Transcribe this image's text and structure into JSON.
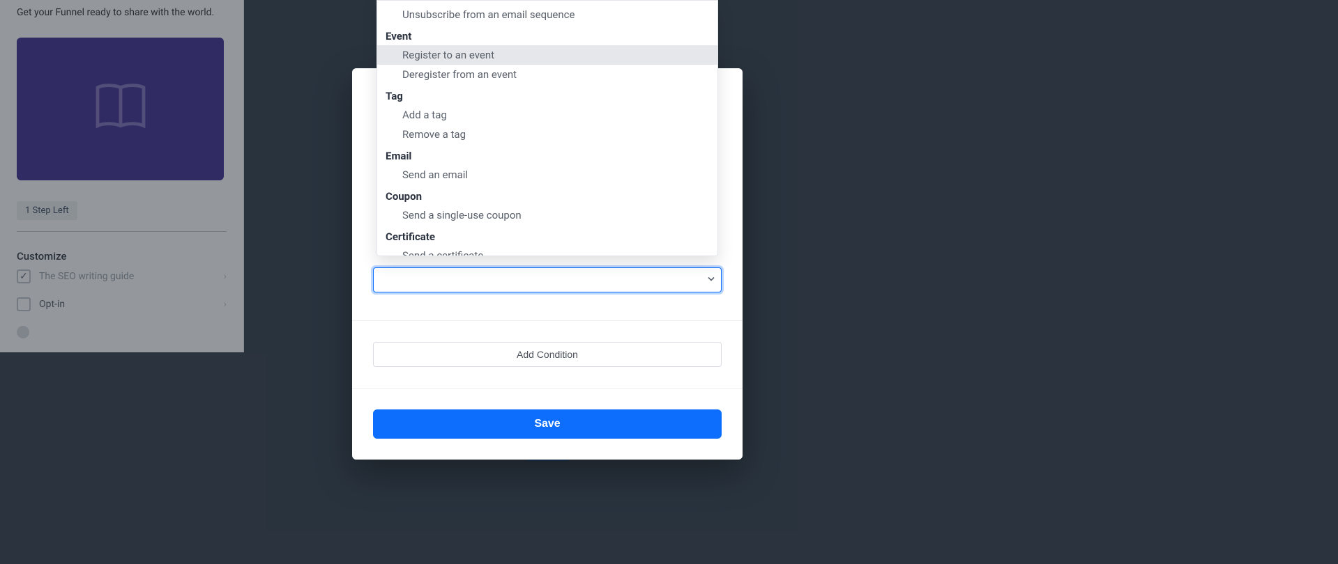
{
  "leftPanel": {
    "subtitle": "Get your Funnel ready to share with the world.",
    "badge": "1 Step Left",
    "customizeTitle": "Customize",
    "items": [
      {
        "label": "The SEO writing guide",
        "checked": true,
        "chevron": true
      },
      {
        "label": "Opt-in",
        "checked": false,
        "chevron": true
      },
      {
        "label": "",
        "checked": false,
        "chevron": false
      }
    ]
  },
  "dropdown": {
    "groups": [
      {
        "label": "",
        "items": [
          "Unsubscribe from an email sequence"
        ]
      },
      {
        "label": "Event",
        "items": [
          "Register to an event",
          "Deregister from an event"
        ]
      },
      {
        "label": "Tag",
        "items": [
          "Add a tag",
          "Remove a tag"
        ]
      },
      {
        "label": "Email",
        "items": [
          "Send an email"
        ]
      },
      {
        "label": "Coupon",
        "items": [
          "Send a single-use coupon"
        ]
      },
      {
        "label": "Certificate",
        "items": [
          "Send a certificate"
        ]
      }
    ],
    "highlighted": "Register to an event"
  },
  "modal": {
    "selectValue": "",
    "addCondition": "Add Condition",
    "save": "Save"
  }
}
